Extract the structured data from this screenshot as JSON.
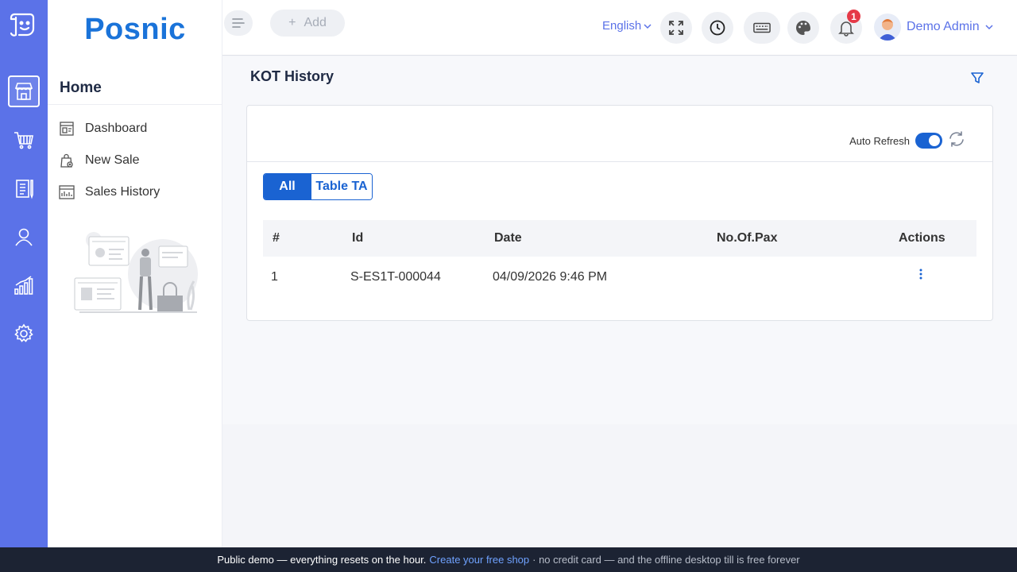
{
  "app": {
    "brand": "Posnic"
  },
  "rail": {
    "items": [
      {
        "icon": "store-icon",
        "active": true
      },
      {
        "icon": "cart-icon",
        "active": false
      },
      {
        "icon": "clipboard-icon",
        "active": false
      },
      {
        "icon": "user-icon",
        "active": false
      },
      {
        "icon": "bar-chart-icon",
        "active": false
      },
      {
        "icon": "gear-icon",
        "active": false
      }
    ]
  },
  "nav": {
    "title": "Home",
    "items": [
      {
        "label": "Dashboard",
        "icon": "dashboard-icon"
      },
      {
        "label": "New Sale",
        "icon": "bag-icon"
      },
      {
        "label": "Sales History",
        "icon": "history-chart-icon"
      }
    ]
  },
  "topbar": {
    "add_label": "Add",
    "language": "English",
    "notification_count": "1",
    "user_name": "Demo Admin"
  },
  "page": {
    "title": "KOT History",
    "auto_refresh_label": "Auto Refresh",
    "auto_refresh_on": true,
    "tabs": [
      {
        "label": "All",
        "active": true
      },
      {
        "label": "Table TA",
        "active": false
      }
    ],
    "table": {
      "columns": [
        "#",
        "Id",
        "Date",
        "No.Of.Pax",
        "Actions"
      ],
      "rows": [
        {
          "num": "1",
          "id": "S-ES1T-000044",
          "date": "04/09/2026 9:46 PM",
          "pax": ""
        }
      ]
    }
  },
  "footer": {
    "text_a": "Public demo — everything resets on the hour.",
    "link": "Create your free shop",
    "text_b": "· no credit card — and the offline desktop till is free forever"
  },
  "colors": {
    "rail": "#5b72e8",
    "primary": "#1a63d2",
    "brand": "#1a73d9",
    "footer": "#1c2333"
  }
}
